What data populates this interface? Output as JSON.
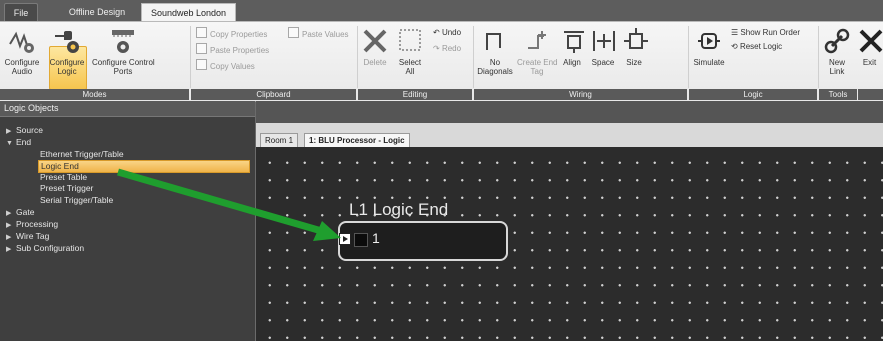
{
  "tabs": {
    "file": "File",
    "offline": "Offline Design",
    "active": "Soundweb London"
  },
  "ribbon": {
    "modes": {
      "label": "Modes",
      "configure_audio": "Configure\nAudio",
      "configure_logic": "Configure\nLogic",
      "configure_control_ports": "Configure Control\nPorts"
    },
    "clipboard": {
      "label": "Clipboard",
      "copy_properties": "Copy Properties",
      "paste_values": "Paste Values",
      "paste_properties": "Paste Properties",
      "copy_values": "Copy Values"
    },
    "editing": {
      "label": "Editing",
      "delete": "Delete",
      "select_all": "Select\nAll",
      "undo": "Undo",
      "redo": "Redo"
    },
    "wiring": {
      "label": "Wiring",
      "no_diagonals": "No\nDiagonals",
      "create_end_tag": "Create End\nTag",
      "align": "Align",
      "space": "Space",
      "size": "Size"
    },
    "logic": {
      "label": "Logic",
      "simulate": "Simulate",
      "show_run_order": "Show Run Order",
      "reset_logic": "Reset Logic"
    },
    "tools": {
      "label": "Tools",
      "new_link": "New\nLink",
      "exit": "Exit"
    }
  },
  "panel": {
    "title": "Logic Objects",
    "items": [
      {
        "label": "Source",
        "arrow": "▶"
      },
      {
        "label": "End",
        "arrow": "▼"
      },
      {
        "label": "Ethernet Trigger/Table",
        "arrow": ""
      },
      {
        "label": "Logic End",
        "arrow": ""
      },
      {
        "label": "Preset Table",
        "arrow": ""
      },
      {
        "label": "Preset Trigger",
        "arrow": ""
      },
      {
        "label": "Serial Trigger/Table",
        "arrow": ""
      },
      {
        "label": "Gate",
        "arrow": "▶"
      },
      {
        "label": "Processing",
        "arrow": "▶"
      },
      {
        "label": "Wire Tag",
        "arrow": "▶"
      },
      {
        "label": "Sub Configuration",
        "arrow": "▶"
      }
    ]
  },
  "document": {
    "tab_room": "Room 1",
    "tab_active": "1: BLU Processor - Logic",
    "block_title": "L1  Logic End",
    "block_pin": "1"
  },
  "colors": {
    "selection": "#f6c54e",
    "arrow": "#1f9e2e",
    "canvas": "#2c2c2c"
  }
}
